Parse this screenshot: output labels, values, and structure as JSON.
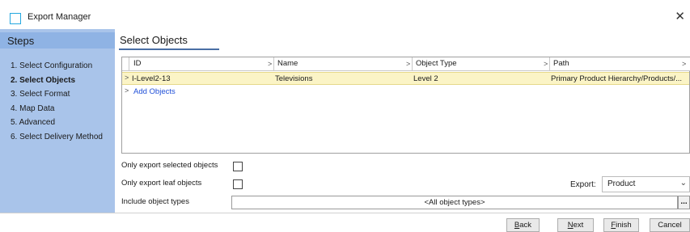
{
  "window": {
    "title": "Export Manager",
    "close_glyph": "✕",
    "icon": "window-square-icon"
  },
  "steps": {
    "header": "Steps",
    "items": [
      {
        "label": "1. Select Configuration",
        "active": false
      },
      {
        "label": "2. Select Objects",
        "active": true
      },
      {
        "label": "3. Select Format",
        "active": false
      },
      {
        "label": "4. Map Data",
        "active": false
      },
      {
        "label": "5. Advanced",
        "active": false
      },
      {
        "label": "6. Select Delivery Method",
        "active": false
      }
    ]
  },
  "main": {
    "title": "Select Objects",
    "table": {
      "columns": [
        "ID",
        "Name",
        "Object Type",
        "Path"
      ],
      "sort_glyph": ">",
      "rows": [
        {
          "id": "I-Level2-13",
          "name": "Televisions",
          "object_type": "Level 2",
          "path": "Primary Product Hierarchy/Products/..."
        }
      ],
      "add_objects": "Add Objects",
      "row_arrow": ">"
    },
    "options": {
      "only_selected_label": "Only export selected objects",
      "only_selected_checked": false,
      "only_leaf_label": "Only export leaf objects",
      "only_leaf_checked": false,
      "include_types_label": "Include object types",
      "include_types_value": "<All object types>",
      "ellipsis": "..."
    },
    "export": {
      "label": "Export:",
      "value": "Product",
      "chevron": "⌄"
    }
  },
  "footer": {
    "buttons": [
      {
        "key": "back",
        "mnemonic": "B",
        "rest": "ack"
      },
      {
        "key": "next",
        "mnemonic": "N",
        "rest": "ext"
      },
      {
        "key": "finish",
        "mnemonic": "F",
        "rest": "inish"
      },
      {
        "key": "cancel",
        "mnemonic": "",
        "rest": "Cancel"
      }
    ]
  },
  "colors": {
    "steps_bg": "#a9c4ea",
    "steps_header_bg": "#8fb3e4",
    "selected_row": "#fbf4c6",
    "link": "#1f4fd8",
    "accent_underline": "#4a6fa5",
    "title_icon": "#25a8e0"
  }
}
